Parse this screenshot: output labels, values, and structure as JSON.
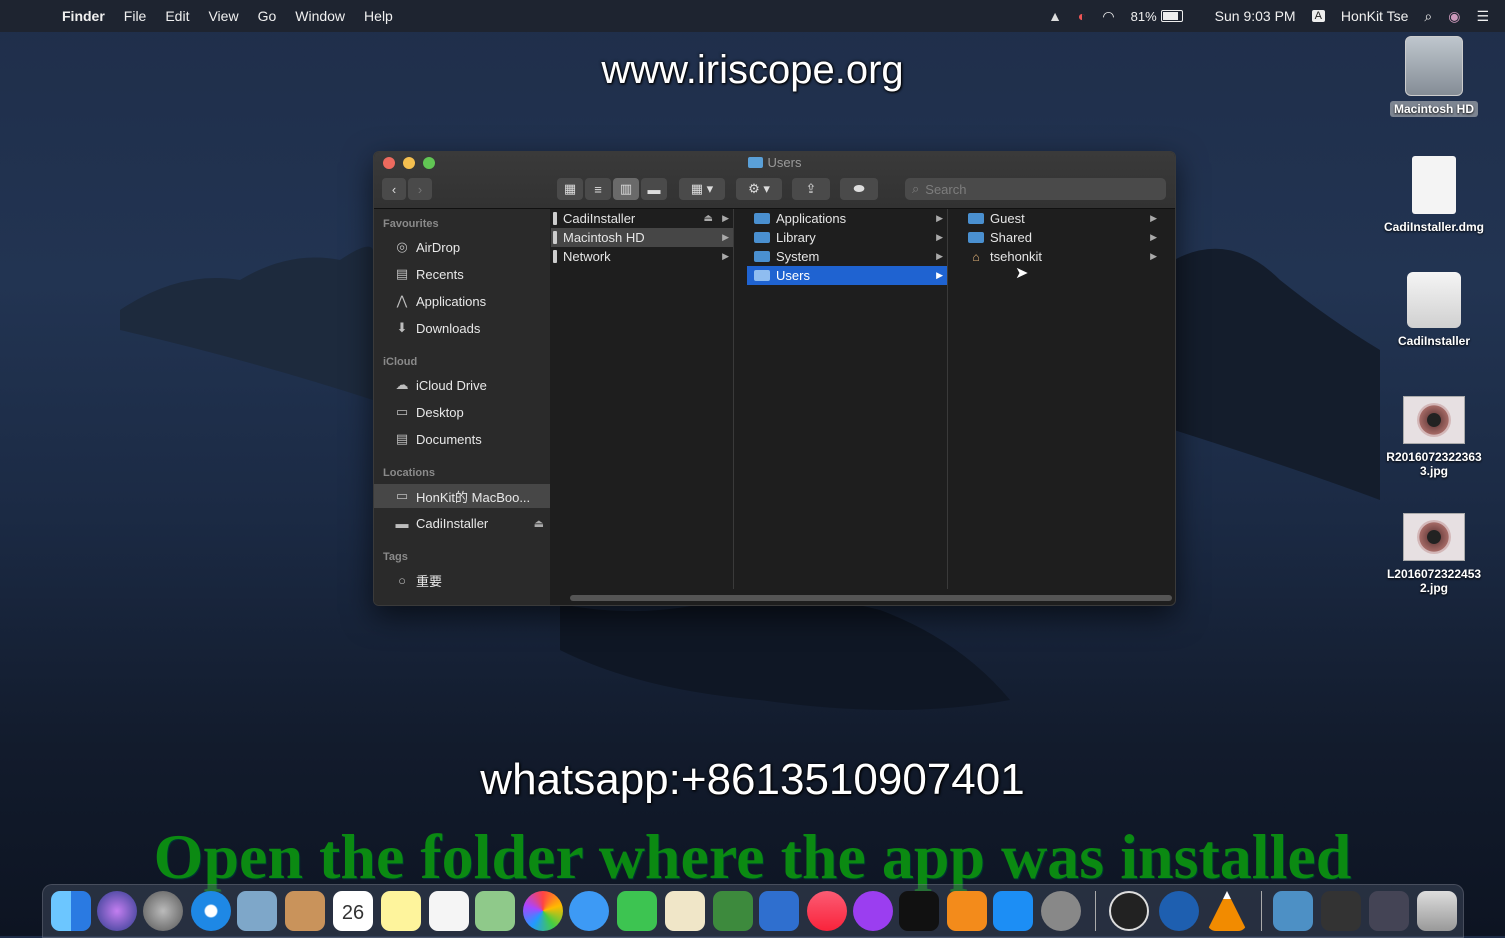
{
  "menubar": {
    "app": "Finder",
    "menus": [
      "File",
      "Edit",
      "View",
      "Go",
      "Window",
      "Help"
    ],
    "battery": "81%",
    "clock": "Sun 9:03 PM",
    "input_source": "A",
    "user": "HonKit Tse"
  },
  "overlays": {
    "website": "www.iriscope.org",
    "whatsapp": "whatsapp:+8613510907401",
    "caption": "Open the folder where the app was installed"
  },
  "finder": {
    "title": "Users",
    "search_placeholder": "Search",
    "sidebar": {
      "favourites_header": "Favourites",
      "favourites": [
        {
          "label": "AirDrop",
          "icon": "airdrop-icon"
        },
        {
          "label": "Recents",
          "icon": "recents-icon"
        },
        {
          "label": "Applications",
          "icon": "applications-icon"
        },
        {
          "label": "Downloads",
          "icon": "downloads-icon"
        }
      ],
      "icloud_header": "iCloud",
      "icloud": [
        {
          "label": "iCloud Drive",
          "icon": "cloud-icon"
        },
        {
          "label": "Desktop",
          "icon": "desktop-icon"
        },
        {
          "label": "Documents",
          "icon": "documents-icon"
        }
      ],
      "locations_header": "Locations",
      "locations": [
        {
          "label": "HonKit的 MacBoo...",
          "icon": "laptop-icon"
        },
        {
          "label": "CadiInstaller",
          "icon": "drive-icon"
        }
      ],
      "tags_header": "Tags",
      "tags": [
        {
          "label": "重要"
        }
      ]
    },
    "columns": [
      [
        "CadiInstaller",
        "Macintosh HD",
        "Network"
      ],
      [
        "Applications",
        "Library",
        "System",
        "Users"
      ],
      [
        "Guest",
        "Shared",
        "tsehonkit"
      ]
    ]
  },
  "desktop": [
    {
      "label": "Macintosh HD"
    },
    {
      "label": "CadiInstaller.dmg"
    },
    {
      "label": "CadiInstaller"
    },
    {
      "label": "R20160723223633.jpg",
      "line1": "R2016072322363",
      "line2": "3.jpg"
    },
    {
      "label": "L20160723224532.jpg",
      "line1": "L2016072322453",
      "line2": "2.jpg"
    }
  ],
  "colors": {
    "selection_blue": "#1f63d1",
    "caption_green": "#0b8a12",
    "folder_blue": "#4a90d0"
  }
}
